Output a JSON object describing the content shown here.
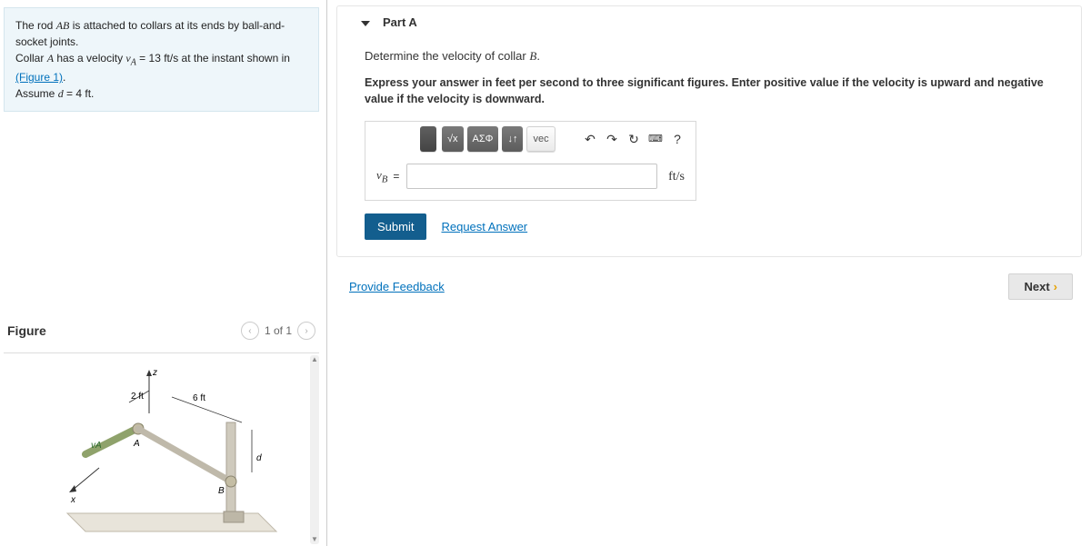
{
  "problem": {
    "line1_pre": "The rod ",
    "line1_var": "AB",
    "line1_post": " is attached to collars at its ends by ball-and-socket joints.",
    "line2_pre": "Collar ",
    "line2_varA": "A",
    "line2_mid": " has a velocity ",
    "line2_vA": "v",
    "line2_vA_sub": "A",
    "line2_eq": " = 13 ft/s at the instant shown in ",
    "figure_link": "(Figure 1)",
    "line2_end": ".",
    "line3_pre": "Assume ",
    "line3_var": "d",
    "line3_val": " = 4 ft."
  },
  "figure": {
    "title": "Figure",
    "pager": "1 of 1",
    "labels": {
      "z": "z",
      "x": "x",
      "two_ft": "2 ft",
      "six_ft": "6 ft",
      "d": "d",
      "vA": "vA",
      "A": "A",
      "B": "B"
    }
  },
  "part": {
    "title": "Part A",
    "question_pre": "Determine the velocity of collar ",
    "question_var": "B",
    "question_post": ".",
    "instruction": "Express your answer in feet per second to three significant figures. Enter positive value if the velocity is upward and negative value if the velocity is downward.",
    "toolbar": {
      "sqrt": "√x",
      "greek": "ΑΣΦ",
      "sort": "↓↑",
      "vec": "vec",
      "undo": "↶",
      "redo": "↷",
      "reset": "↻",
      "keyboard": "⌨",
      "help": "?"
    },
    "answer": {
      "label": "v",
      "label_sub": "B",
      "eq": "=",
      "units": "ft/s"
    },
    "submit": "Submit",
    "request": "Request Answer"
  },
  "footer": {
    "feedback": "Provide Feedback",
    "next": "Next"
  }
}
